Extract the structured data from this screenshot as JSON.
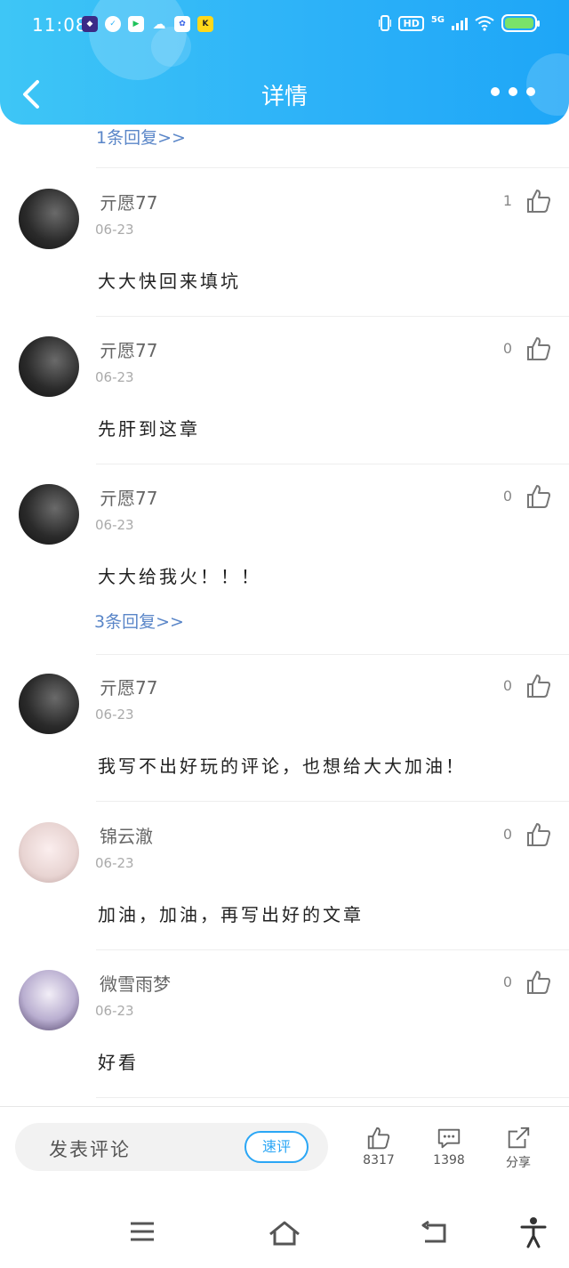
{
  "status_bar": {
    "time": "11:08",
    "network": "5G",
    "hd_label": "HD",
    "app_icons": [
      "game-app-icon",
      "compass-app-icon",
      "video-app-icon",
      "wechat-icon",
      "baidu-icon",
      "kuaikan-icon"
    ]
  },
  "nav": {
    "title": "详情",
    "back_icon": "chevron-left-icon",
    "more_icon": "more-dots-icon"
  },
  "top_reply_link": "1条回复>>",
  "comments": [
    {
      "user": "亓愿77",
      "date": "06-23",
      "likes": "1",
      "text": "大大快回来填坑",
      "avatar": "dark",
      "reply_link": ""
    },
    {
      "user": "亓愿77",
      "date": "06-23",
      "likes": "0",
      "text": "先肝到这章",
      "avatar": "dark",
      "reply_link": ""
    },
    {
      "user": "亓愿77",
      "date": "06-23",
      "likes": "0",
      "text": "大大给我火！！！",
      "avatar": "dark",
      "reply_link": "3条回复>>"
    },
    {
      "user": "亓愿77",
      "date": "06-23",
      "likes": "0",
      "text": "我写不出好玩的评论，也想给大大加油！",
      "avatar": "dark",
      "reply_link": ""
    },
    {
      "user": "锦云澈",
      "date": "06-23",
      "likes": "0",
      "text": "加油，加油，再写出好的文章",
      "avatar": "white",
      "reply_link": ""
    },
    {
      "user": "微雪雨梦",
      "date": "06-23",
      "likes": "0",
      "text": "好看",
      "avatar": "purple",
      "reply_link": ""
    }
  ],
  "action_bar": {
    "comment_placeholder": "发表评论",
    "quick_comment": "速评",
    "like_count": "8317",
    "comment_count": "1398",
    "share_label": "分享"
  },
  "system_nav": {
    "icons": [
      "menu-icon",
      "home-icon",
      "back-icon",
      "accessibility-icon"
    ]
  },
  "colors": {
    "header_start": "#3ec6f6",
    "header_end": "#1ea6f7",
    "link": "#5a86c8",
    "accent": "#2aa6f5",
    "battery": "#7ae26a"
  }
}
